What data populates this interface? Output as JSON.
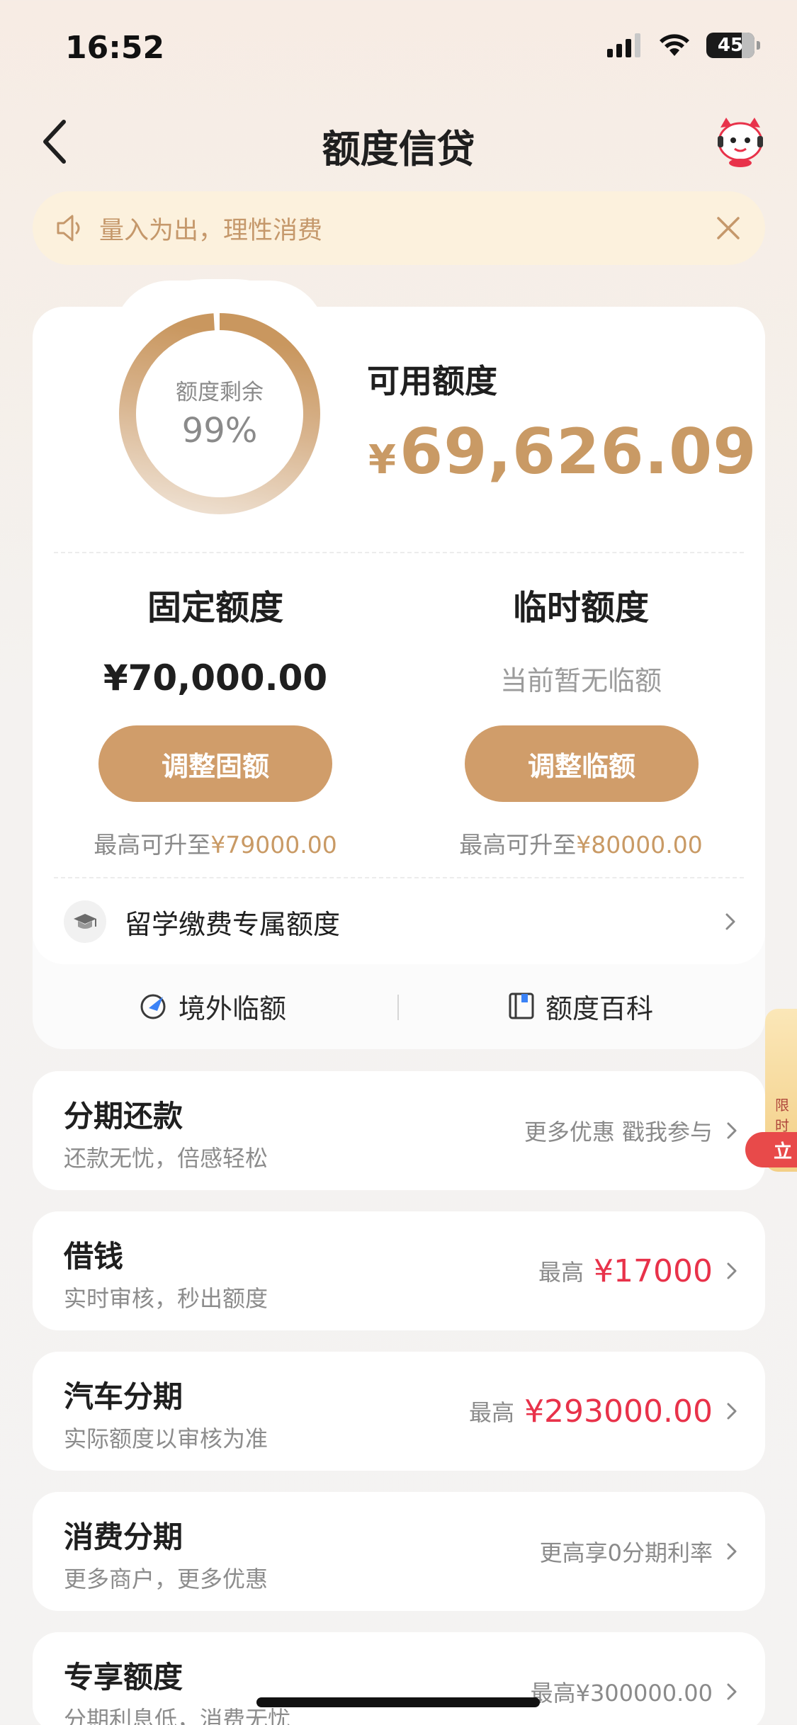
{
  "status_bar": {
    "time": "16:52",
    "battery": "45"
  },
  "nav": {
    "title": "额度信贷"
  },
  "notice": {
    "text": "量入为出，理性消费"
  },
  "credit": {
    "ring_label": "额度剩余",
    "ring_percent": "99%",
    "ring_fraction": 0.99,
    "available_label": "可用额度",
    "available_currency": "¥",
    "available_amount": "69,626.09",
    "fixed": {
      "title": "固定额度",
      "amount": "¥70,000.00",
      "button": "调整固额",
      "max_prefix": "最高可升至",
      "max_value": "¥79000.00"
    },
    "temporary": {
      "title": "临时额度",
      "status": "当前暂无临额",
      "button": "调整临额",
      "max_prefix": "最高可升至",
      "max_value": "¥80000.00"
    },
    "study_abroad": "留学缴费专属额度",
    "links": {
      "overseas": "境外临额",
      "wiki": "额度百科"
    }
  },
  "products": [
    {
      "title": "分期还款",
      "subtitle": "还款无忧，倍感轻松",
      "right_text": "更多优惠 戳我参与",
      "right_value": ""
    },
    {
      "title": "借钱",
      "subtitle": "实时审核，秒出额度",
      "right_text": "最高",
      "right_value": "¥17000"
    },
    {
      "title": "汽车分期",
      "subtitle": "实际额度以审核为准",
      "right_text": "最高",
      "right_value": "¥293000.00"
    },
    {
      "title": "消费分期",
      "subtitle": "更多商户，更多优惠",
      "right_text": "更高享0分期利率",
      "right_value": ""
    },
    {
      "title": "专享额度",
      "subtitle": "分期利息低，消费无忧",
      "right_text": "最高¥300000.00",
      "right_value": ""
    }
  ],
  "side_promo": {
    "tag": "限时",
    "button": "立"
  },
  "colors": {
    "gold": "#c99a65",
    "button": "#d09d6a",
    "red": "#e8324a",
    "notice_bg": "#fcf1dd"
  }
}
